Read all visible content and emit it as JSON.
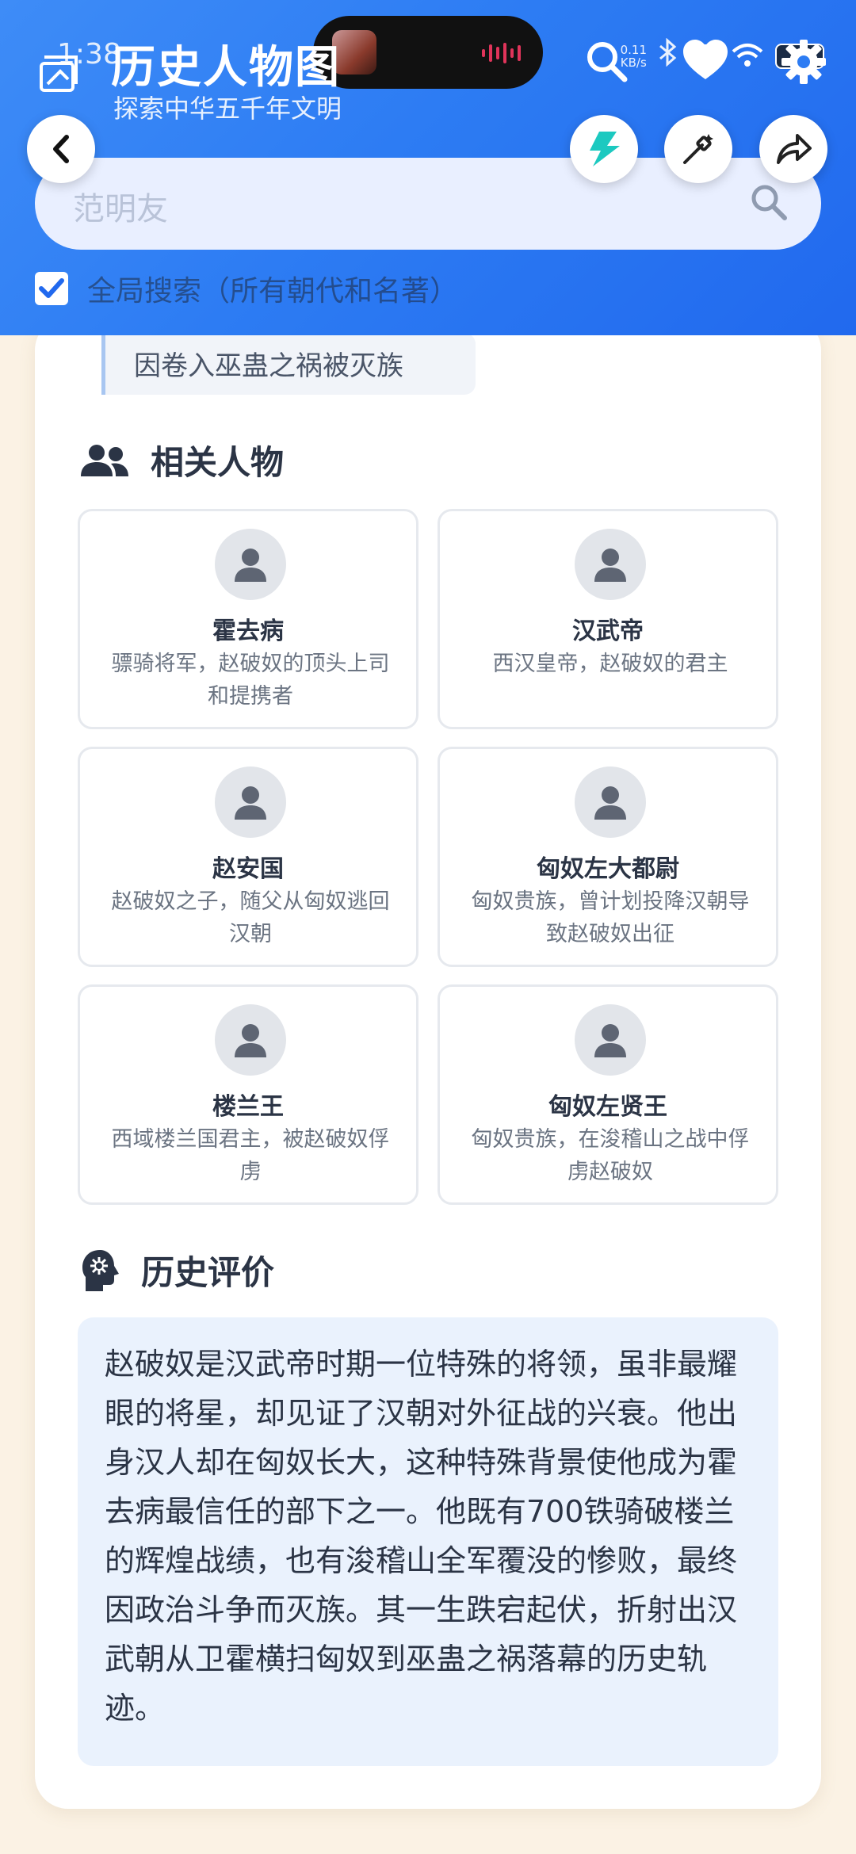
{
  "status_bar": {
    "time": "1:38",
    "net_speed_value": "0.11",
    "net_speed_unit": "KB/s",
    "battery": "79"
  },
  "header": {
    "title": "历史人物图",
    "subtitle": "探索中华五千年文明",
    "search_placeholder": "范明友",
    "global_search_label": "全局搜索（所有朝代和名著）",
    "global_search_checked": true,
    "accent_color": "#2d7cf3"
  },
  "quote": "因卷入巫蛊之祸被灭族",
  "related": {
    "title": "相关人物",
    "people": [
      {
        "name": "霍去病",
        "desc": "骠骑将军，赵破奴的顶头上司和提携者"
      },
      {
        "name": "汉武帝",
        "desc": "西汉皇帝，赵破奴的君主"
      },
      {
        "name": "赵安国",
        "desc": "赵破奴之子，随父从匈奴逃回汉朝"
      },
      {
        "name": "匈奴左大都尉",
        "desc": "匈奴贵族，曾计划投降汉朝导致赵破奴出征"
      },
      {
        "name": "楼兰王",
        "desc": "西域楼兰国君主，被赵破奴俘虏"
      },
      {
        "name": "匈奴左贤王",
        "desc": "匈奴贵族，在浚稽山之战中俘虏赵破奴"
      }
    ]
  },
  "evaluation": {
    "title": "历史评价",
    "text": "赵破奴是汉武帝时期一位特殊的将领，虽非最耀眼的将星，却见证了汉朝对外征战的兴衰。他出身汉人却在匈奴长大，这种特殊背景使他成为霍去病最信任的部下之一。他既有700铁骑破楼兰的辉煌战绩，也有浚稽山全军覆没的惨败，最终因政治斗争而灭族。其一生跌宕起伏，折射出汉武朝从卫霍横扫匈奴到巫蛊之祸落幕的历史轨迹。"
  },
  "icons": [
    "back-icon",
    "flash-icon",
    "magic-wand-icon",
    "share-icon",
    "search-icon",
    "heart-icon",
    "gear-icon",
    "people-icon",
    "brain-head-icon",
    "person-icon",
    "checkmark-icon",
    "bluetooth-icon",
    "wifi-icon"
  ]
}
